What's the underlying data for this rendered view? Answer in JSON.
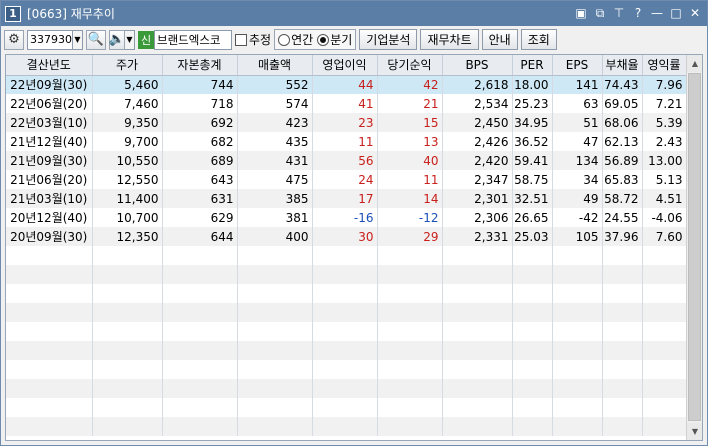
{
  "window": {
    "number": "1",
    "title": "[0663] 재무추이"
  },
  "toolbar": {
    "code": "337930",
    "sin_badge": "신",
    "stock_name": "브랜드엑스코",
    "estimate_label": "추정",
    "radio_annual": "연간",
    "radio_quarter": "분기",
    "selected_radio": "분기",
    "btn_company": "기업분석",
    "btn_chart": "재무차트",
    "btn_guide": "안내",
    "btn_query": "조회"
  },
  "table": {
    "headers": [
      "결산년도",
      "주가",
      "자본총계",
      "매출액",
      "영업이익",
      "당기순익",
      "BPS",
      "PER",
      "EPS",
      "부채율",
      "영익률"
    ],
    "rows": [
      [
        "22년09월(30)",
        "5,460",
        "744",
        "552",
        "44",
        "42",
        "2,618",
        "18.00",
        "141",
        "74.43",
        "7.96"
      ],
      [
        "22년06월(20)",
        "7,460",
        "718",
        "574",
        "41",
        "21",
        "2,534",
        "25.23",
        "63",
        "69.05",
        "7.21"
      ],
      [
        "22년03월(10)",
        "9,350",
        "692",
        "423",
        "23",
        "15",
        "2,450",
        "34.95",
        "51",
        "68.06",
        "5.39"
      ],
      [
        "21년12월(40)",
        "9,700",
        "682",
        "435",
        "11",
        "13",
        "2,426",
        "36.52",
        "47",
        "62.13",
        "2.43"
      ],
      [
        "21년09월(30)",
        "10,550",
        "689",
        "431",
        "56",
        "40",
        "2,420",
        "59.41",
        "134",
        "56.89",
        "13.00"
      ],
      [
        "21년06월(20)",
        "12,550",
        "643",
        "475",
        "24",
        "11",
        "2,347",
        "58.75",
        "34",
        "65.83",
        "5.13"
      ],
      [
        "21년03월(10)",
        "11,400",
        "631",
        "385",
        "17",
        "14",
        "2,301",
        "32.51",
        "49",
        "58.72",
        "4.51"
      ],
      [
        "20년12월(40)",
        "10,700",
        "629",
        "381",
        "-16",
        "-12",
        "2,306",
        "26.65",
        "-42",
        "24.55",
        "-4.06"
      ],
      [
        "20년09월(30)",
        "12,350",
        "644",
        "400",
        "30",
        "29",
        "2,331",
        "25.03",
        "105",
        "37.96",
        "7.60"
      ]
    ]
  },
  "colors": {
    "positive": "#c8201c",
    "negative": "#1a4fb8",
    "selected_row": "#cfe8f6",
    "title_bar": "#5a7ea6"
  }
}
